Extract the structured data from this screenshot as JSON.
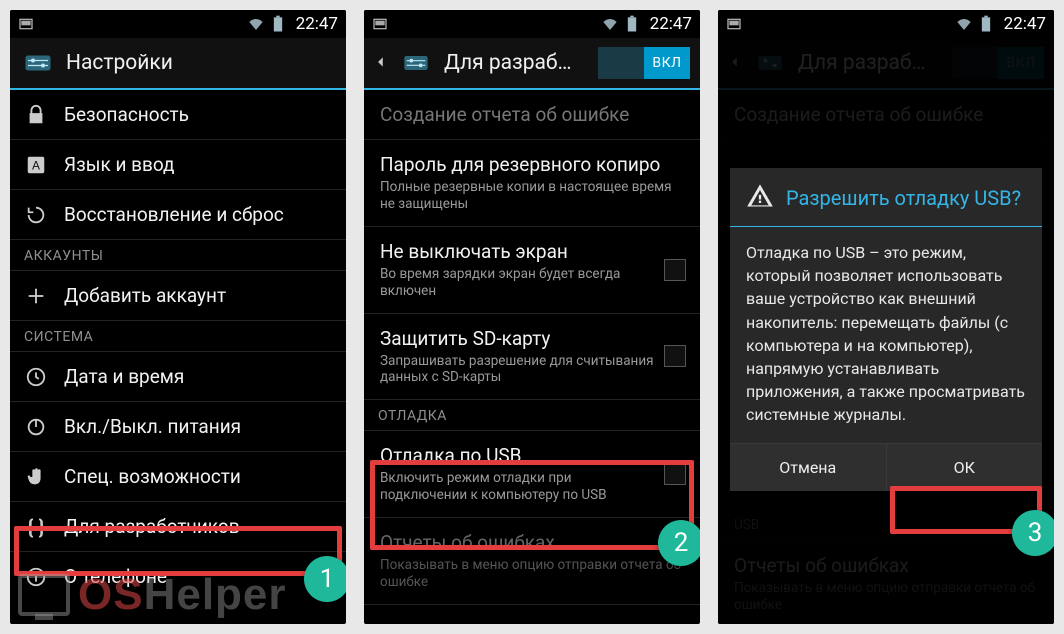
{
  "status": {
    "time": "22:47"
  },
  "screen1": {
    "title": "Настройки",
    "items": [
      {
        "icon": "lock",
        "title": "Безопасность"
      },
      {
        "icon": "lang",
        "title": "Язык и ввод"
      },
      {
        "icon": "restore",
        "title": "Восстановление и сброс"
      }
    ],
    "section_accounts": "АККАУНТЫ",
    "add_account": "Добавить аккаунт",
    "section_system": "СИСТЕМА",
    "system_items": [
      {
        "icon": "clock",
        "title": "Дата и время"
      },
      {
        "icon": "power",
        "title": "Вкл./Выкл. питания"
      },
      {
        "icon": "hand",
        "title": "Спец. возможности"
      },
      {
        "icon": "braces",
        "title": "Для разработчиков"
      },
      {
        "icon": "info",
        "title": "О телефоне"
      }
    ]
  },
  "screen2": {
    "title": "Для разраб…",
    "toggle": "ВКЛ",
    "rows": {
      "bugreport": {
        "title": "Создание отчета об ошибке"
      },
      "backup_pw": {
        "title": "Пароль для резервного копиро",
        "sub": "Полные резервные копии в настоящее время не защищены"
      },
      "stay_awake": {
        "title": "Не выключать экран",
        "sub": "Во время зарядки экран будет всегда включен"
      },
      "protect_sd": {
        "title": "Защитить SD-карту",
        "sub": "Запрашивать разрешение для считывания данных с SD-карты"
      },
      "section_debug": "ОТЛАДКА",
      "usb_debug": {
        "title": "Отладка по USB",
        "sub": "Включить режим отладки при подключении к компьютеру по USB"
      },
      "error_reports": {
        "title": "Отчеты об ошибках",
        "sub": "Показывать в меню опцию отправки отчета об ошибке"
      }
    }
  },
  "screen3": {
    "title": "Для разраб…",
    "toggle": "ВКЛ",
    "dialog": {
      "title": "Разрешить отладку USB?",
      "body": "Отладка по USB – это режим, который позволяет использовать ваше устройство как внешний накопитель: перемещать файлы (с компьютера и на компьютер), напрямую устанавливать приложения, а также просматривать системные журналы.",
      "cancel": "Отмена",
      "ok": "ОК"
    },
    "bg_usb_label": "USB",
    "bg_error_reports": {
      "title": "Отчеты об ошибках",
      "sub": "Показывать в меню опцию отправки отчета об ошибке"
    }
  },
  "badges": {
    "one": "1",
    "two": "2",
    "three": "3"
  },
  "watermark": {
    "a": "OS",
    "b": "Helper"
  }
}
